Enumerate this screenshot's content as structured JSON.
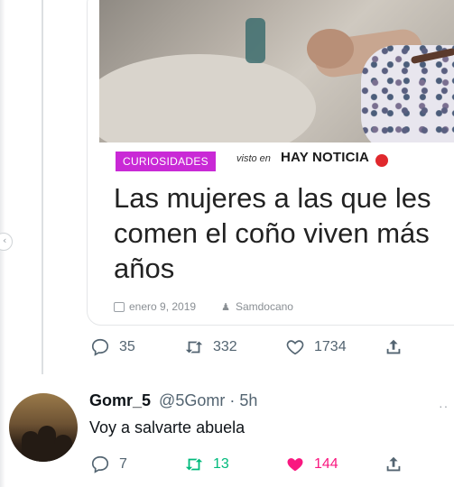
{
  "quoted_card": {
    "category": "CURIOSIDADES",
    "seen_on": "visto en",
    "brand": "HAY NOTICIA",
    "headline": "Las mujeres a las que les comen el coño viven más años",
    "date": "enero 9, 2019",
    "author": "Samdocano"
  },
  "tweet_actions": {
    "replies": "35",
    "retweets": "332",
    "likes": "1734"
  },
  "reply_tweet": {
    "display_name": "Gomr_5",
    "handle_time": "@5Gomr · 5h",
    "text": "Voy a salvarte abuela",
    "more": "··",
    "replies": "7",
    "retweets": "13",
    "likes": "144"
  },
  "icons": {
    "reply": "reply-icon",
    "retweet": "retweet-icon",
    "like": "heart-icon",
    "share": "share-icon",
    "nav": "chevron-left-icon"
  },
  "colors": {
    "tag": "#c929d6",
    "retweet_active": "#00ba7c",
    "like_active": "#f91880",
    "muted": "#536471"
  }
}
